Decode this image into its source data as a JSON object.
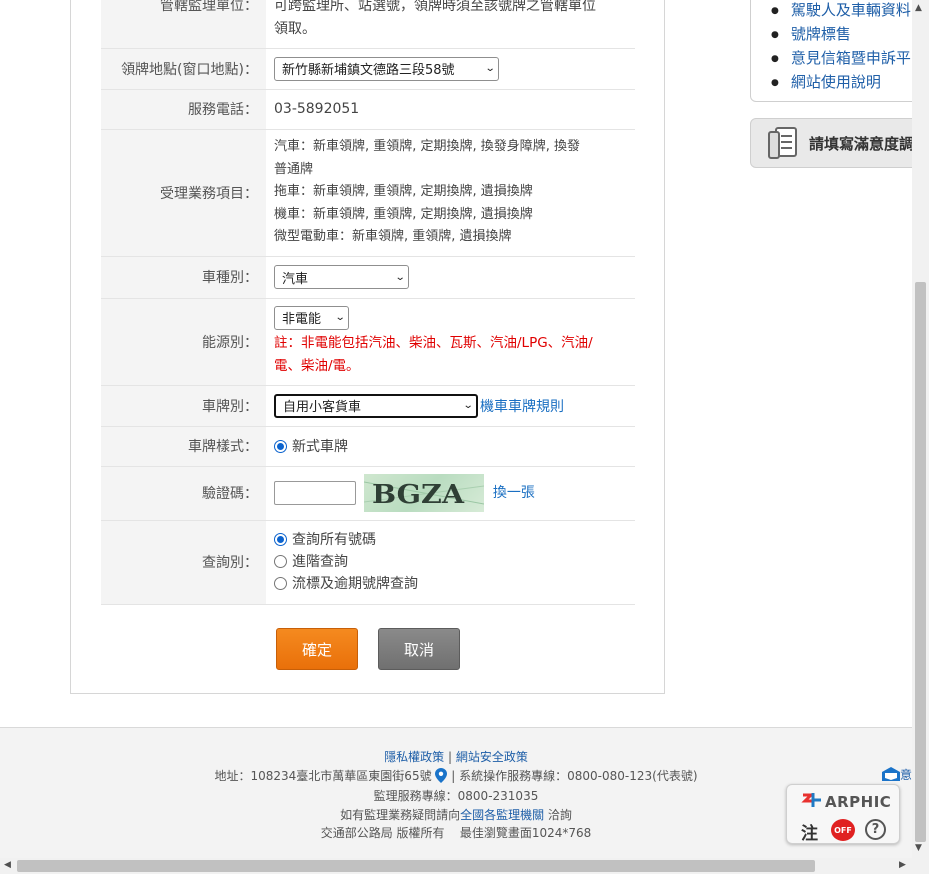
{
  "form": {
    "jurisdiction": {
      "label": "管轄監理單位：",
      "note_line1": "可跨監理所、站選號，領牌時須至該號牌之管轄單位",
      "note_line2": "領取。"
    },
    "location": {
      "label": "領牌地點(窗口地點)：",
      "selected": "新竹縣新埔鎮文德路三段58號"
    },
    "phone": {
      "label": "服務電話：",
      "value": "03-5892051"
    },
    "services": {
      "label": "受理業務項目：",
      "lines": [
        "汽車：新車領牌, 重領牌, 定期換牌, 換發身障牌, 換發",
        "普通牌",
        "拖車：新車領牌, 重領牌, 定期換牌, 遺損換牌",
        "機車：新車領牌, 重領牌, 定期換牌, 遺損換牌",
        "微型電動車：新車領牌, 重領牌, 遺損換牌"
      ]
    },
    "vehicle_type": {
      "label": "車種別：",
      "selected": "汽車"
    },
    "energy": {
      "label": "能源別：",
      "selected": "非電能",
      "note_line1": "註：非電能包括汽油、柴油、瓦斯、汽油/LPG、汽油/",
      "note_line2": "電、柴油/電。"
    },
    "plate_type": {
      "label": "車牌別：",
      "selected": "自用小客貨車",
      "rules_link": "機車車牌規則"
    },
    "plate_style": {
      "label": "車牌樣式：",
      "option": "新式車牌"
    },
    "captcha": {
      "label": "驗證碼：",
      "image_text": "BGZA",
      "refresh": "換一張"
    },
    "query_type": {
      "label": "查詢別：",
      "options": [
        "查詢所有號碼",
        "進階查詢",
        "流標及逾期號牌查詢"
      ],
      "selected_index": 0
    },
    "ok_button": "確定",
    "cancel_button": "取消"
  },
  "sidebar": {
    "links": [
      "駕駛人及車輛資料",
      "號牌標售",
      "意見信箱暨申訴平",
      "網站使用說明"
    ],
    "survey_label": "請填寫滿意度調"
  },
  "footer": {
    "privacy": "隱私權政策",
    "separator": "|",
    "security": "網站安全政策",
    "address": "地址：108234臺北市萬華區東園街65號",
    "hotline": "系統操作服務專線：0800-080-123(代表號)",
    "service_line": "監理服務專線：0800-231035",
    "inquiry_prefix": "如有監理業務疑問請向",
    "inquiry_link": "全國各監理機關",
    "inquiry_suffix": "洽詢",
    "copyright": "交通部公路局 版權所有",
    "best_view": "最佳瀏覽畫面1024*768",
    "mail_fragment": "意"
  },
  "arphic": {
    "brand": "ARPHIC",
    "zhu": "注",
    "off": "OFF",
    "help": "?"
  },
  "colors": {
    "accent_orange": "#f0800f",
    "link_blue": "#1a6fc2",
    "alert_red": "#e00000",
    "radio_blue": "#0b63ce"
  },
  "icons": [
    "location-pin-icon",
    "mail-icon",
    "survey-doc-icon",
    "chevron-down-icon",
    "help-icon"
  ]
}
